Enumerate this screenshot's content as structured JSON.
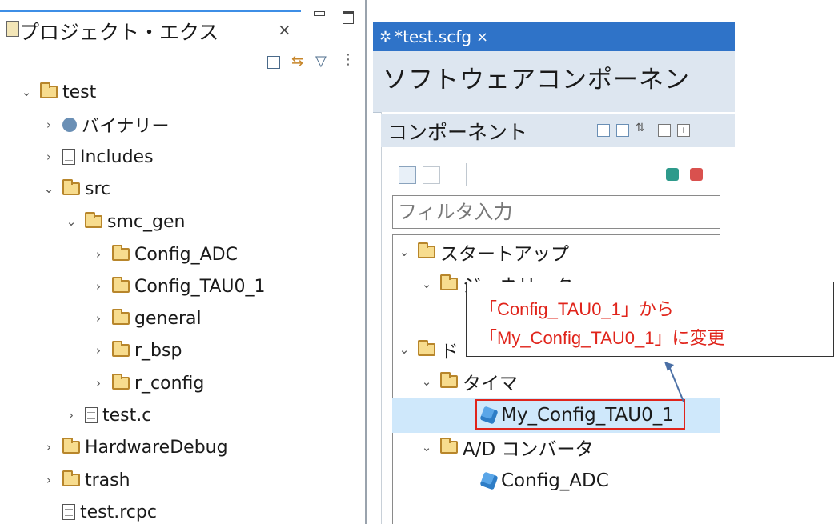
{
  "left_panel": {
    "tab_title": "プロジェクト・エクス",
    "tab_close": "×",
    "minimize": "▭",
    "maximize": "▢",
    "tree": [
      {
        "label": "test",
        "chevron": "⌄",
        "icon": "project-folder-icon"
      },
      {
        "label": "バイナリー",
        "chevron": "›",
        "icon": "binaries-icon"
      },
      {
        "label": "Includes",
        "chevron": "›",
        "icon": "includes-icon"
      },
      {
        "label": "src",
        "chevron": "⌄",
        "icon": "source-folder-icon"
      },
      {
        "label": "smc_gen",
        "chevron": "⌄",
        "icon": "folder-icon"
      },
      {
        "label": "Config_ADC",
        "chevron": "›",
        "icon": "folder-icon"
      },
      {
        "label": "Config_TAU0_1",
        "chevron": "›",
        "icon": "folder-icon"
      },
      {
        "label": "general",
        "chevron": "›",
        "icon": "folder-icon"
      },
      {
        "label": "r_bsp",
        "chevron": "›",
        "icon": "folder-icon"
      },
      {
        "label": "r_config",
        "chevron": "›",
        "icon": "folder-icon"
      },
      {
        "label": "test.c",
        "chevron": "›",
        "icon": "c-file-icon"
      },
      {
        "label": "HardwareDebug",
        "chevron": "›",
        "icon": "folder-icon"
      },
      {
        "label": "trash",
        "chevron": "›",
        "icon": "folder-icon"
      },
      {
        "label": "test.rcpc",
        "chevron": "",
        "icon": "file-icon"
      }
    ]
  },
  "editor": {
    "tab_title": "*test.scfg",
    "tab_close": "×",
    "header_title": "ソフトウェアコンポーネン",
    "section_title": "コンポーネント",
    "filter_placeholder": "フィルタ入力",
    "tree": [
      {
        "label": "スタートアップ",
        "chevron": "⌄"
      },
      {
        "label": "ジェネリック",
        "chevron": "⌄"
      },
      {
        "label": "ド",
        "chevron": "⌄"
      },
      {
        "label": "タイマ",
        "chevron": "⌄"
      },
      {
        "label": "My_Config_TAU0_1",
        "chevron": ""
      },
      {
        "label": "A/D コンバータ",
        "chevron": "⌄"
      },
      {
        "label": "Config_ADC",
        "chevron": ""
      }
    ]
  },
  "callout": {
    "line1": "「Config_TAU0_1」から",
    "line2": "「My_Config_TAU0_1」に変更"
  },
  "colors": {
    "accent": "#2f73c8",
    "selection": "#cfe8fb",
    "highlight": "#e0241b"
  }
}
